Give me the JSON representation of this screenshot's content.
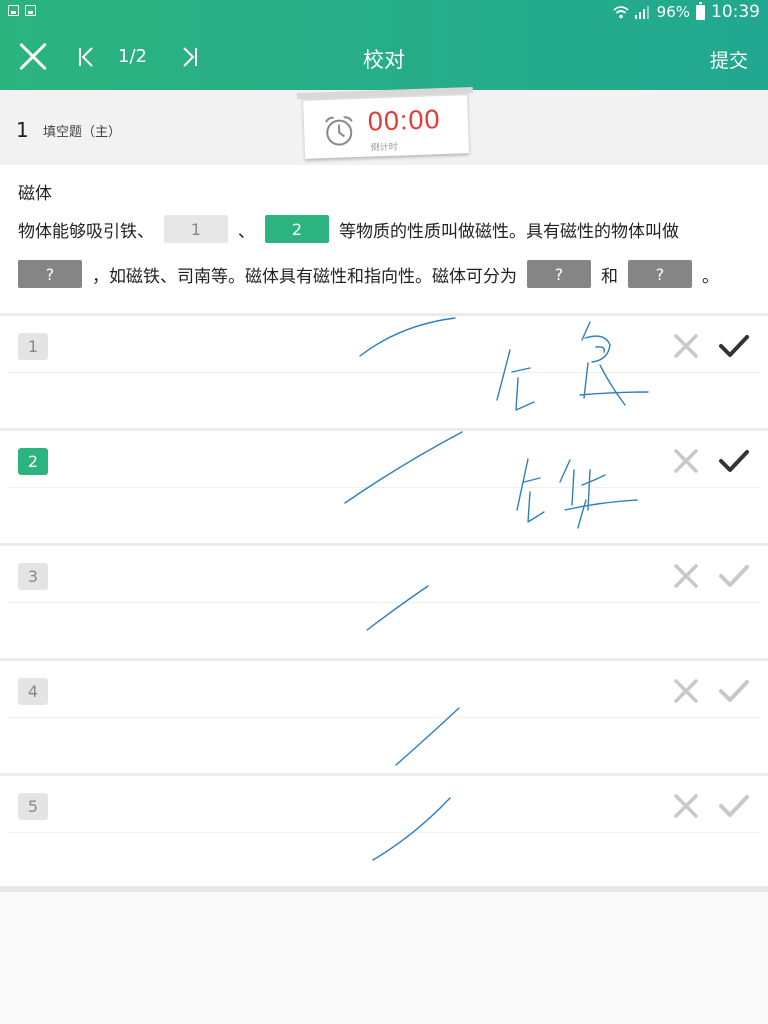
{
  "status_bar": {
    "battery": "96%",
    "time": "10:39"
  },
  "header": {
    "title": "校对",
    "page_indicator": "1/2",
    "submit_label": "提交"
  },
  "question_bar": {
    "number": "1",
    "type": "填空题（主）",
    "timer_value": "00:00",
    "timer_label": "倒计时"
  },
  "question": {
    "title": "磁体",
    "line1": {
      "text_a": "物体能够吸引铁、",
      "blank1": "1",
      "sep": "、",
      "blank2": "2",
      "text_b": "等物质的性质叫做磁性。具有磁性的物体叫做"
    },
    "line2": {
      "blank3": "?",
      "text_a": "，如磁铁、司南等。磁体具有磁性和指向性。磁体可分为",
      "blank4": "?",
      "text_b": "和",
      "blank5": "?",
      "text_c": "。"
    }
  },
  "answers": [
    {
      "number": "1",
      "active": false,
      "graded": true
    },
    {
      "number": "2",
      "active": true,
      "graded": true
    },
    {
      "number": "3",
      "active": false,
      "graded": false
    },
    {
      "number": "4",
      "active": false,
      "graded": false
    },
    {
      "number": "5",
      "active": false,
      "graded": false
    }
  ],
  "colors": {
    "brand": "#2bb37f",
    "timer": "#e53935",
    "ink": "#2f7fbd",
    "check_dark": "#333333",
    "mark_light": "#c8c8c8"
  }
}
